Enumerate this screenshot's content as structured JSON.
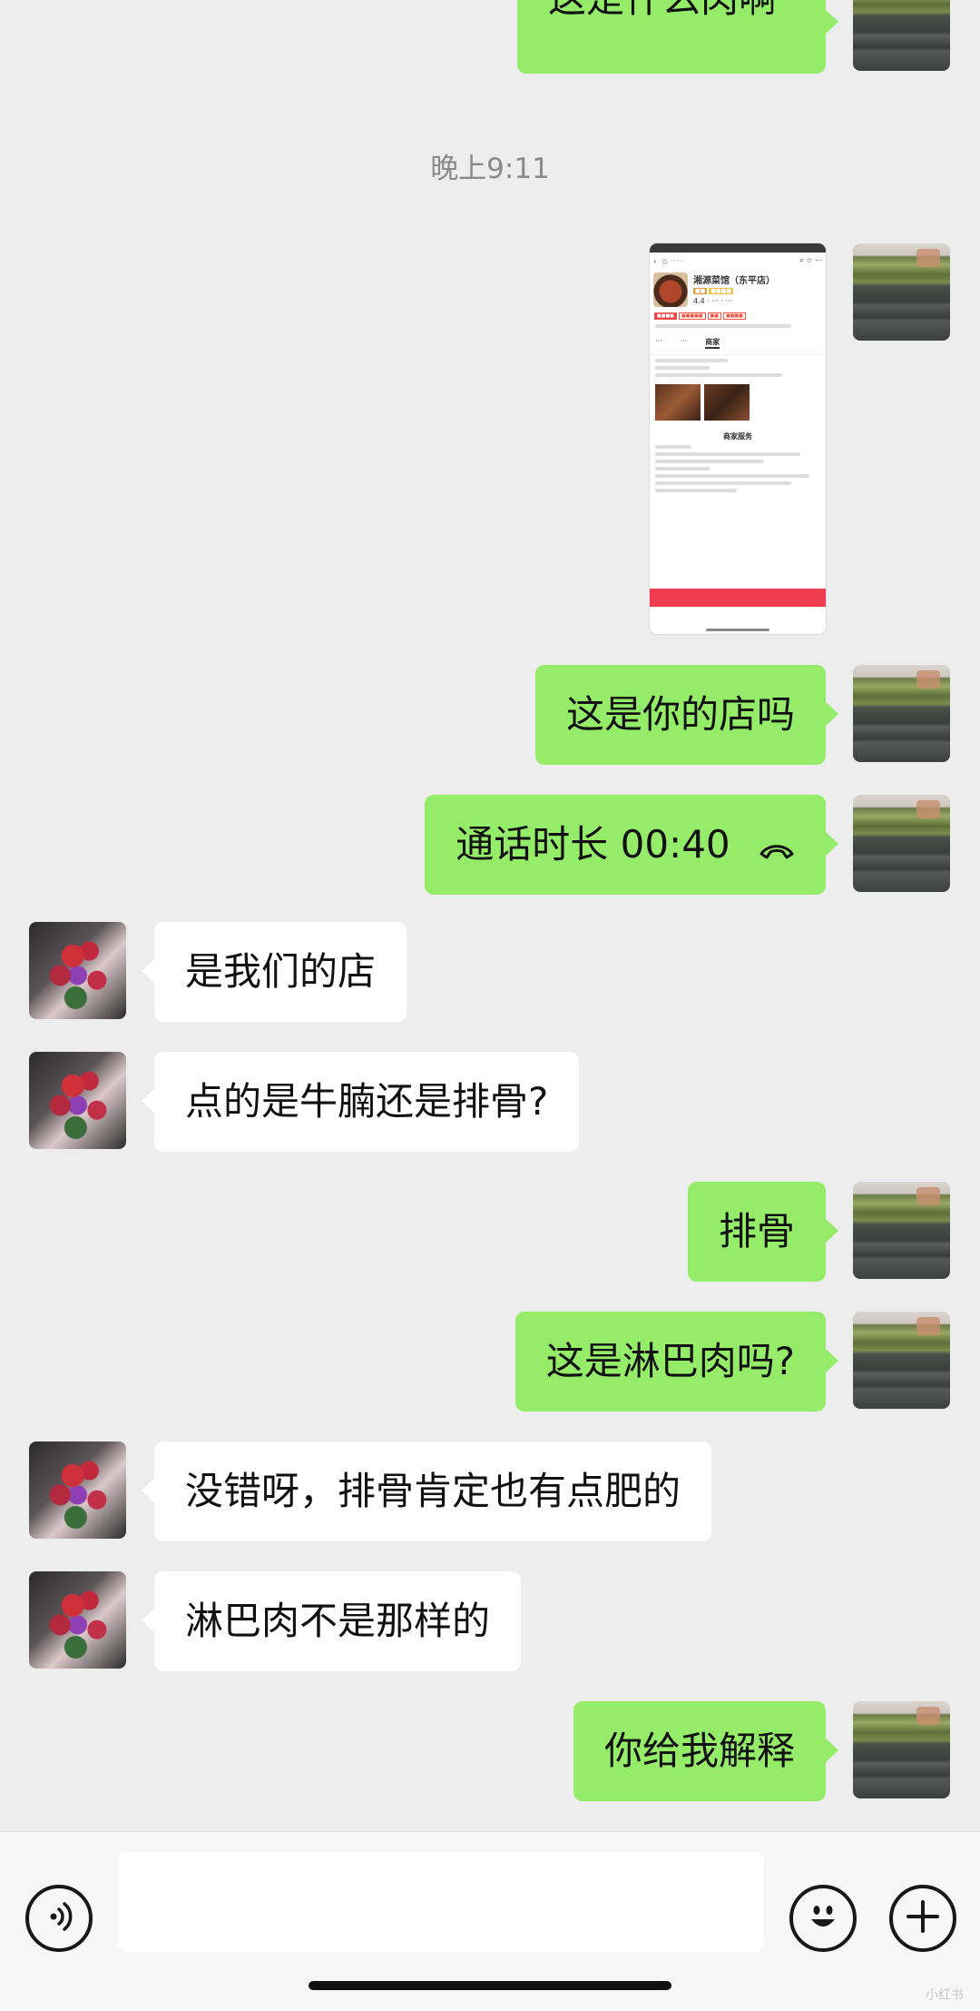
{
  "timestamp": "晚上9:11",
  "messages": [
    {
      "sender": "me",
      "text": "这是什么肉啊"
    },
    {
      "sender": "me",
      "type": "image",
      "description": "shop page screenshot"
    },
    {
      "sender": "me",
      "text": "这是你的店吗"
    },
    {
      "sender": "me",
      "type": "call",
      "text": "通话时长 00:40"
    },
    {
      "sender": "other",
      "text": "是我们的店"
    },
    {
      "sender": "other",
      "text": "点的是牛腩还是排骨?"
    },
    {
      "sender": "me",
      "text": "排骨"
    },
    {
      "sender": "me",
      "text": "这是淋巴肉吗?"
    },
    {
      "sender": "other",
      "text": "没错呀，排骨肯定也有点肥的"
    },
    {
      "sender": "other",
      "text": "淋巴肉不是那样的"
    },
    {
      "sender": "me",
      "text": "你给我解释"
    }
  ],
  "shot": {
    "shop_name": "湘源菜馆（东平店）",
    "tab_merchant": "商家",
    "section_title": "商家服务",
    "rating": "4.4"
  },
  "input": {
    "placeholder": ""
  },
  "colors": {
    "me_bubble": "#95ec69",
    "other_bubble": "#ffffff",
    "background": "#ededed"
  },
  "watermark": "小红书"
}
